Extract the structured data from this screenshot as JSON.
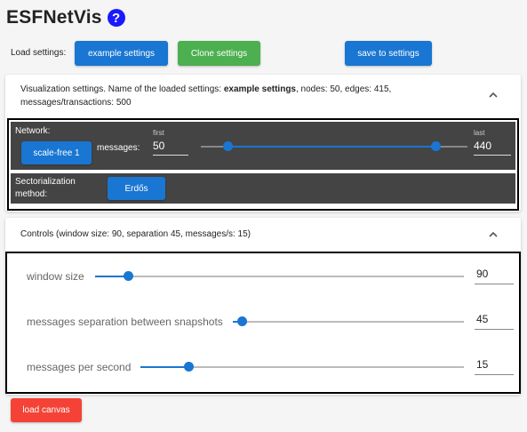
{
  "app": {
    "title": "ESFNetVis",
    "help_symbol": "?"
  },
  "load_bar": {
    "label": "Load settings:",
    "example_button": "example settings",
    "clone_button": "Clone settings",
    "save_button": "save to settings"
  },
  "viz_panel": {
    "header_prefix": "Visualization settings. Name of the loaded settings: ",
    "settings_name": "example settings",
    "header_suffix": ", nodes: 50, edges: 415,",
    "header_line2": "messages/transactions: 500",
    "network": {
      "label": "Network:",
      "button": "scale-free 1",
      "messages_label": "messages:",
      "first_label": "first",
      "first_value": "50",
      "last_label": "last",
      "last_value": "440",
      "range_min_fraction": 0.1,
      "range_max_fraction": 0.88
    },
    "sectorialization": {
      "label_line1": "Sectorialization",
      "label_line2": "method:",
      "button": "Erdős"
    }
  },
  "controls_panel": {
    "header": "Controls (window size: 90, separation 45, messages/s: 15)",
    "sliders": [
      {
        "label": "window size",
        "value": "90",
        "fraction": 0.09
      },
      {
        "label": "messages separation between snapshots",
        "value": "45",
        "fraction": 0.04
      },
      {
        "label": "messages per second",
        "value": "15",
        "fraction": 0.15
      }
    ]
  },
  "load_canvas_button": "load canvas",
  "colors": {
    "primary": "#1976d2",
    "success": "#4caf50",
    "danger": "#f44336",
    "dark_row": "#444444",
    "help": "#1a1aff"
  }
}
